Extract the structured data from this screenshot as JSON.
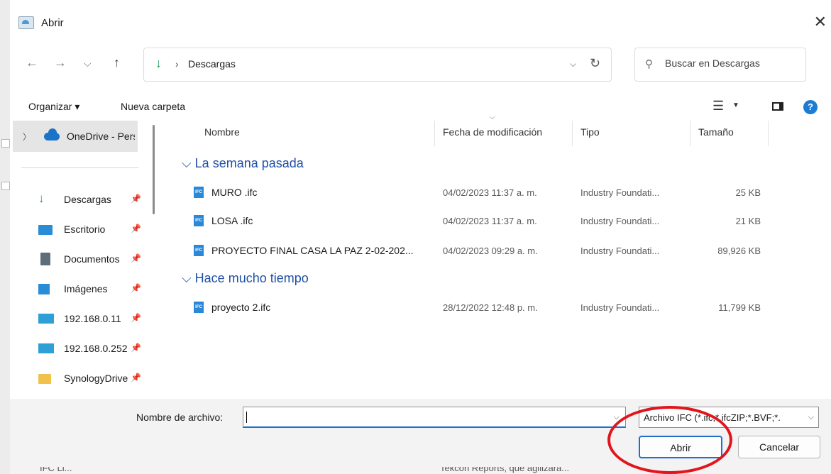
{
  "background": {
    "text_left": "IFC Li...",
    "text_right": "Tekcon Reports, que agilizará..."
  },
  "dialog": {
    "title": "Abrir",
    "app_icon": "app-logo-icon",
    "close_icon": "close-icon"
  },
  "nav": {
    "back": "←",
    "forward": "→",
    "recent": "⌵",
    "up": "↑",
    "address_icon": "download-arrow-icon",
    "address_sep": "›",
    "address": "Descargas",
    "address_chevron": "⌵",
    "refresh": "↻",
    "search_placeholder": "Buscar en Descargas"
  },
  "toolbar": {
    "organize": "Organizar ▾",
    "new_folder": "Nueva carpeta",
    "help": "?"
  },
  "sidebar": {
    "onedrive": "OneDrive - Personal",
    "items": [
      {
        "label": "Descargas",
        "icon": "download-icon"
      },
      {
        "label": "Escritorio",
        "icon": "desktop-icon"
      },
      {
        "label": "Documentos",
        "icon": "documents-icon"
      },
      {
        "label": "Imágenes",
        "icon": "pictures-icon"
      },
      {
        "label": "192.168.0.11",
        "icon": "network-drive-icon"
      },
      {
        "label": "192.168.0.252",
        "icon": "network-drive-icon"
      },
      {
        "label": "SynologyDrive",
        "icon": "synology-folder-icon"
      }
    ],
    "pin": "📌"
  },
  "columns": {
    "name": "Nombre",
    "date": "Fecha de modificación",
    "type": "Tipo",
    "size": "Tamaño"
  },
  "groups": [
    {
      "title": "La semana pasada",
      "files": [
        {
          "name": "MURO .ifc",
          "date": "04/02/2023 11:37 a. m.",
          "type": "Industry Foundati...",
          "size": "25 KB"
        },
        {
          "name": "LOSA .ifc",
          "date": "04/02/2023 11:37 a. m.",
          "type": "Industry Foundati...",
          "size": "21 KB"
        },
        {
          "name": "PROYECTO FINAL CASA LA PAZ 2-02-202...",
          "date": "04/02/2023 09:29 a. m.",
          "type": "Industry Foundati...",
          "size": "89,926 KB"
        }
      ]
    },
    {
      "title": "Hace mucho tiempo",
      "files": [
        {
          "name": "proyecto 2.ifc",
          "date": "28/12/2022 12:48 p. m.",
          "type": "Industry Foundati...",
          "size": "11,799 KB"
        }
      ]
    }
  ],
  "file_icon_label": "IFC",
  "bottom": {
    "filename_label": "Nombre de archivo:",
    "filename_value": "",
    "filetype": "Archivo IFC (*.ifc;*.ifcZIP;*.BVF;*.",
    "open": "Abrir",
    "cancel": "Cancelar"
  },
  "colors": {
    "accent": "#1e6fd0",
    "group_header": "#1e4fa6",
    "annotation": "#e2141c"
  }
}
